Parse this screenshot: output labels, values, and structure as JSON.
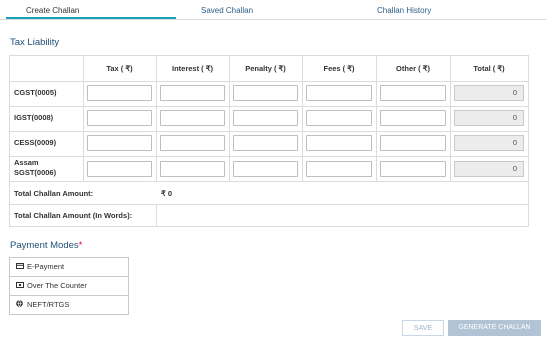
{
  "tabs": [
    {
      "label": "Create Challan"
    },
    {
      "label": "Saved Challan"
    },
    {
      "label": "Challan History"
    }
  ],
  "tax_liability": {
    "title": "Tax Liability",
    "columns": [
      "Tax ( ₹)",
      "Interest ( ₹)",
      "Penalty ( ₹)",
      "Fees ( ₹)",
      "Other ( ₹)",
      "Total ( ₹)"
    ],
    "rows": [
      {
        "label": "CGST(0005)",
        "total": "0"
      },
      {
        "label": "IGST(0008)",
        "total": "0"
      },
      {
        "label": "CESS(0009)",
        "total": "0"
      },
      {
        "label": "Assam SGST(0006)",
        "total": "0"
      }
    ],
    "total_amount_label": "Total Challan Amount:",
    "total_amount_value": "₹ 0",
    "total_words_label": "Total Challan Amount (In Words):",
    "total_words_value": ""
  },
  "payment_modes": {
    "title": "Payment Modes",
    "required_mark": "*",
    "items": [
      {
        "label": "E-Payment",
        "icon": "card-icon"
      },
      {
        "label": "Over The Counter",
        "icon": "cash-icon"
      },
      {
        "label": "NEFT/RTGS",
        "icon": "globe-icon"
      }
    ]
  },
  "buttons": {
    "save": "SAVE",
    "generate": "GENERATE CHALLAN"
  }
}
